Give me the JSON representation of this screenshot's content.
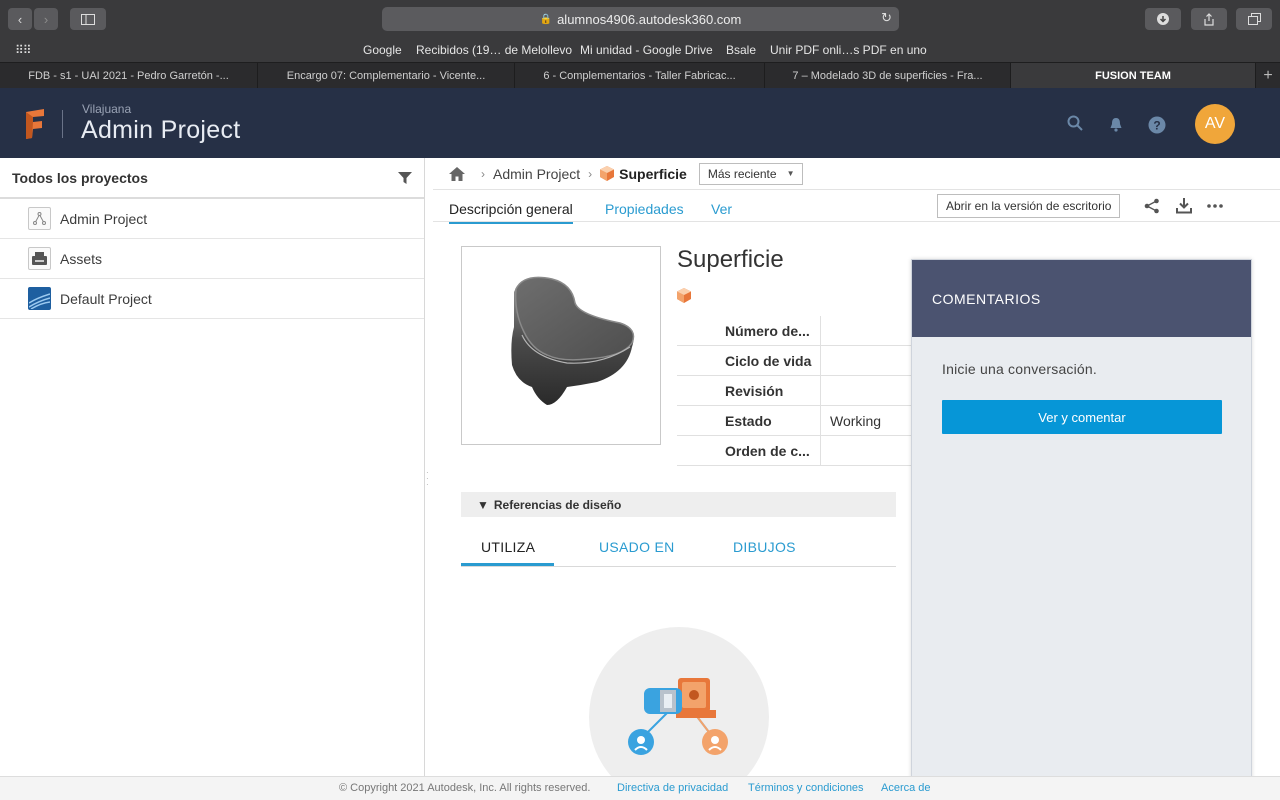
{
  "browser": {
    "url": "alumnos4906.autodesk360.com",
    "favorites": [
      "Google",
      "Recibidos (19… de Melollevo",
      "Mi unidad - Google Drive",
      "Bsale",
      "Unir PDF onli…s PDF en uno"
    ],
    "tabs": [
      {
        "label": "FDB - s1 - UAI 2021 - Pedro Garretón -..."
      },
      {
        "label": "Encargo 07: Complementario - Vicente..."
      },
      {
        "label": "6 - Complementarios - Taller Fabricac..."
      },
      {
        "label": "7 – Modelado 3D de superficies - Fra..."
      },
      {
        "label": "FUSION TEAM"
      }
    ]
  },
  "header": {
    "hub": "Vilajuana",
    "project": "Admin Project",
    "avatar_initials": "AV"
  },
  "sidebar": {
    "title": "Todos los proyectos",
    "items": [
      {
        "label": "Admin Project"
      },
      {
        "label": "Assets"
      },
      {
        "label": "Default Project"
      }
    ]
  },
  "breadcrumb": {
    "project": "Admin Project",
    "current": "Superficie",
    "version": "Más reciente"
  },
  "tabs": {
    "overview": "Descripción general",
    "properties": "Propiedades",
    "view": "Ver",
    "open_desktop": "Abrir en la versión de escritorio"
  },
  "file": {
    "title": "Superficie",
    "properties": [
      {
        "key": "Número de...",
        "value": ""
      },
      {
        "key": "Ciclo de vida",
        "value": ""
      },
      {
        "key": "Revisión",
        "value": ""
      },
      {
        "key": "Estado",
        "value": "Working"
      },
      {
        "key": "Orden de c...",
        "value": ""
      }
    ]
  },
  "references": {
    "header": "Referencias de diseño",
    "tabs": [
      "UTILIZA",
      "USADO EN",
      "DIBUJOS"
    ]
  },
  "comments": {
    "title": "COMENTARIOS",
    "prompt": "Inicie una conversación.",
    "button": "Ver y comentar"
  },
  "footer": {
    "copyright": "© Copyright 2021 Autodesk, Inc. All rights reserved.",
    "privacy": "Directiva de privacidad",
    "terms": "Términos y condiciones",
    "about": "Acerca de"
  },
  "colors": {
    "header_bg": "#263046",
    "accent": "#0696d7",
    "avatar": "#f0a63a",
    "comments_header": "#4b5370"
  }
}
